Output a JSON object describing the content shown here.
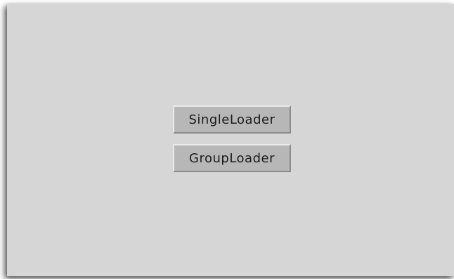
{
  "buttons": {
    "single_loader": "SingleLoader",
    "group_loader": "GroupLoader"
  },
  "colors": {
    "panel_background": "#d6d6d6",
    "button_face": "#b7b7b7"
  }
}
